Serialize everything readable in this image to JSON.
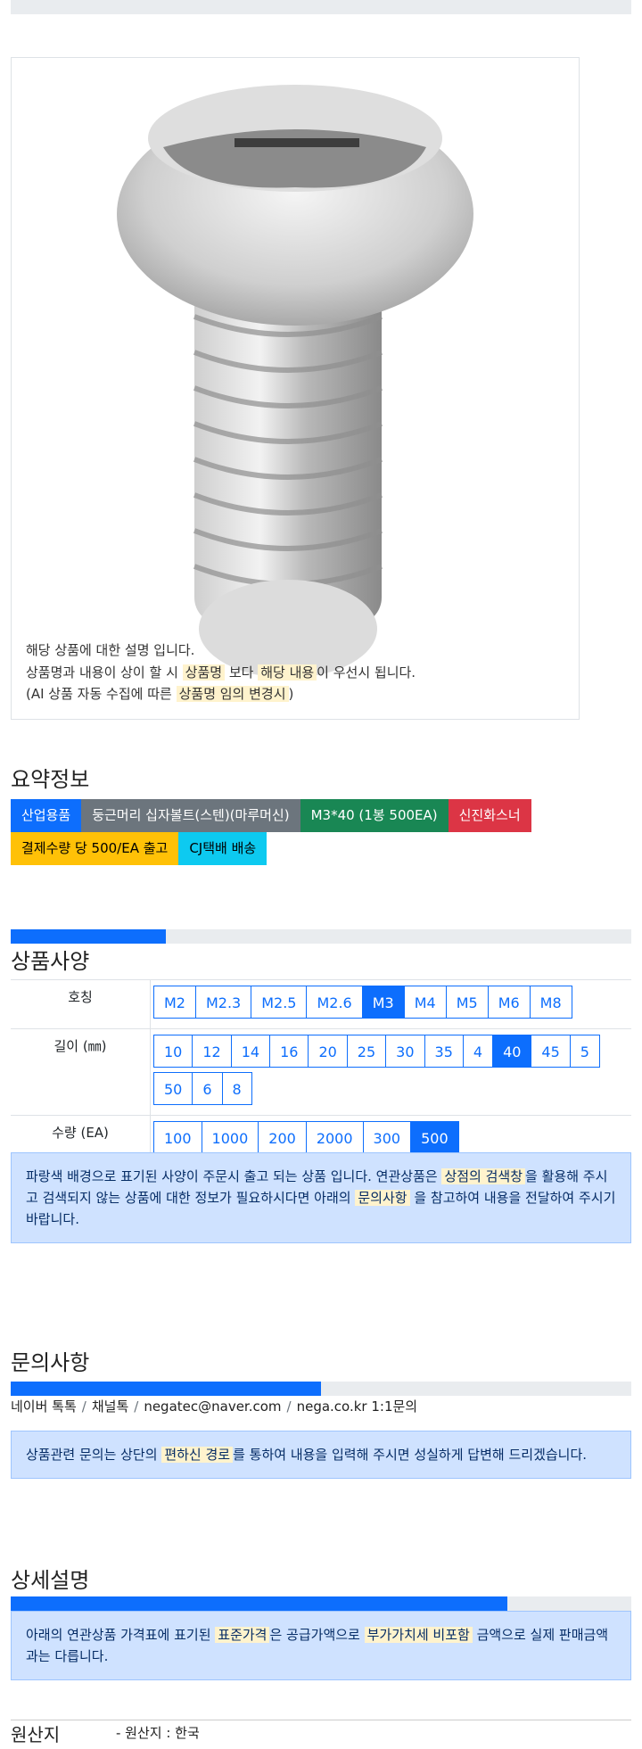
{
  "image_caption": {
    "line1": "해당 상품에 대한 설명 입니다.",
    "line2_a": "상품명과 내용이 상이 할 시 ",
    "line2_b": "상품명",
    "line2_c": " 보다 ",
    "line2_d": "해당 내용",
    "line2_e": "이 우선시 됩니다.",
    "line3_a": "(AI 상품 자동 수집에 따른 ",
    "line3_b": "상품명 임의 변경시",
    "line3_c": ")"
  },
  "summary": {
    "title": "요약정보",
    "badges": [
      "산업용품",
      "둥근머리 십자볼트(스텐)(마루머신)",
      "M3*40 (1봉 500EA)",
      "신진화스너",
      "결제수량 당 500/EA 출고",
      "CJ택배 배송"
    ],
    "colors": [
      "#0d6efd",
      "#6c757d",
      "#198754",
      "#dc3545",
      "#ffc107",
      "#0dcaf0"
    ]
  },
  "specs": {
    "progress": 0.25,
    "title": "상품사양",
    "rows": [
      {
        "label": "호칭",
        "options": [
          "M2",
          "M2.3",
          "M2.5",
          "M2.6",
          "M3",
          "M4",
          "M5",
          "M6",
          "M8"
        ],
        "selected": "M3"
      },
      {
        "label": "길이 (㎜)",
        "options": [
          "10",
          "12",
          "14",
          "16",
          "20",
          "25",
          "30",
          "35",
          "4",
          "40",
          "45",
          "5",
          "50",
          "6",
          "8"
        ],
        "selected": "40"
      },
      {
        "label": "수량 (EA)",
        "options": [
          "100",
          "1000",
          "200",
          "2000",
          "300",
          "500"
        ],
        "selected": "500"
      }
    ],
    "notice_a": "파랑색 배경으로 표기된 사양이 주문시 출고 되는 상품 입니다. 연관상품은 ",
    "notice_b": "상점의 검색창",
    "notice_c": "을 활용해 주시고 검색되지 않는 상품에 대한 정보가 필요하시다면 아래의 ",
    "notice_d": "문의사항",
    "notice_e": " 을 참고하여 내용을 전달하여 주시기 바랍니다."
  },
  "inquiry": {
    "title": "문의사항",
    "progress": 0.5,
    "channels": [
      "네이버 톡톡",
      "채널톡",
      "negatec@naver.com",
      "nega.co.kr 1:1문의"
    ],
    "notice_a": "상품관련 문의는 상단의 ",
    "notice_b": "편하신 경로",
    "notice_c": "를 통하여 내용을 입력해 주시면 성실하게 답변해 드리겠습니다."
  },
  "detail": {
    "title": "상세설명",
    "progress": 0.8,
    "notice_a": "아래의 연관상품 가격표에 표기된 ",
    "notice_b": "표준가격",
    "notice_c": "은 공급가액으로 ",
    "notice_d": "부가가치세 비포함",
    "notice_e": " 금액으로 실제 판매금액과는 다릅니다."
  },
  "origin": {
    "title": "원산지",
    "value": "- 원산지 : 한국"
  }
}
